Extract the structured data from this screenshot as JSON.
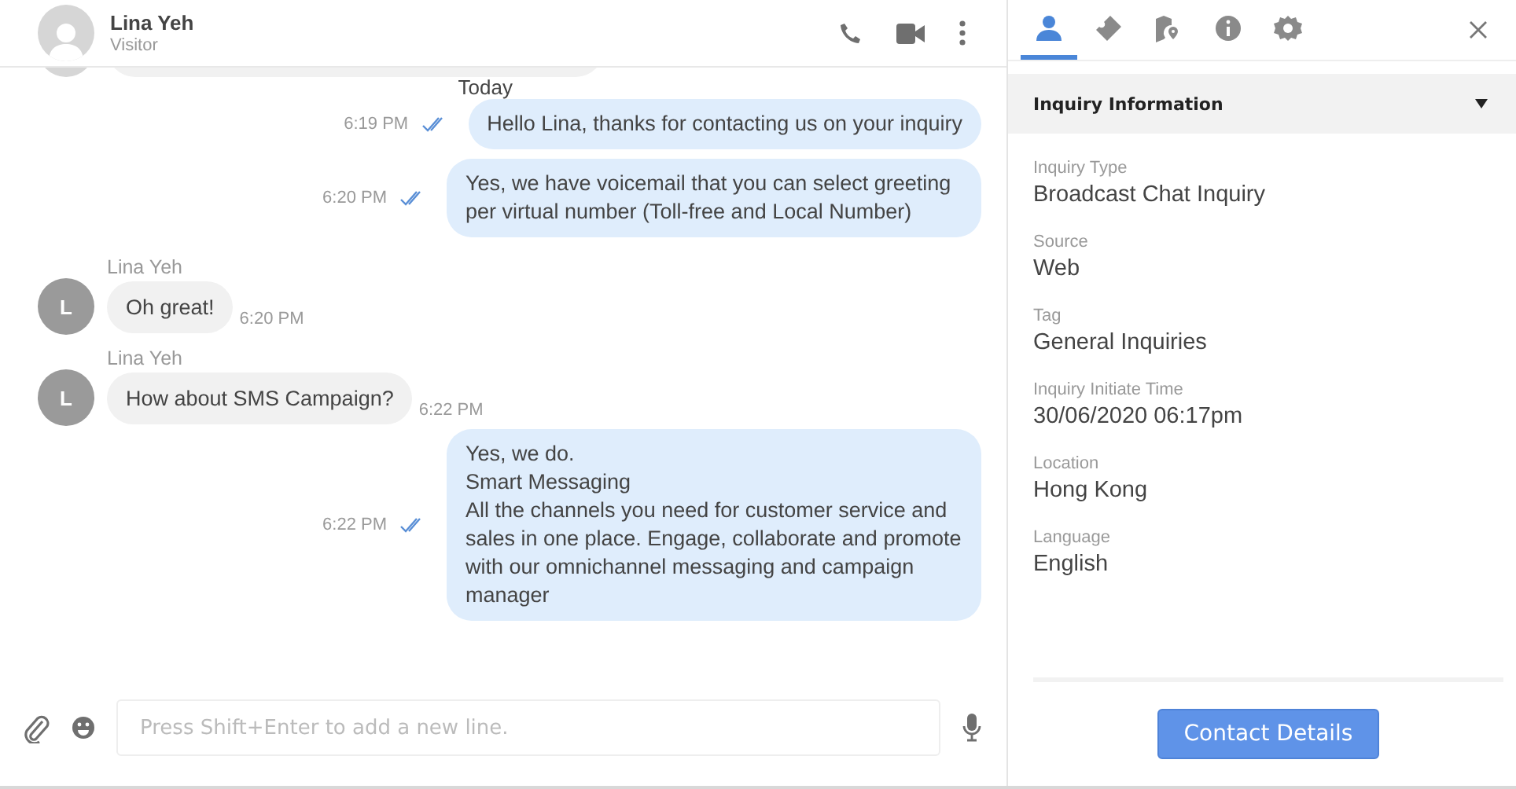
{
  "header": {
    "name": "Lina Yeh",
    "status": "Visitor"
  },
  "messages": [
    {
      "kind": "cut"
    },
    {
      "kind": "date",
      "text": "Today"
    },
    {
      "kind": "outgoing",
      "text": "Hello Lina, thanks for contacting us on your inquiry",
      "time": "6:19 PM",
      "read": true
    },
    {
      "kind": "outgoing",
      "text": "Yes, we have voicemail that you can select greeting per virtual number (Toll-free and Local Number)",
      "time": "6:20 PM",
      "read": true
    },
    {
      "kind": "incoming",
      "sender": "Lina Yeh",
      "avatar": "L",
      "text": "Oh great!",
      "time": "6:20 PM"
    },
    {
      "kind": "incoming",
      "sender": "Lina Yeh",
      "avatar": "L",
      "text": "How about SMS Campaign?",
      "time": "6:22 PM"
    },
    {
      "kind": "outgoing",
      "text": "Yes, we do.\nSmart Messaging\nAll the channels you need for customer service and sales in one place. Engage, collaborate and promote with our omnichannel messaging and campaign manager",
      "time": "6:22 PM",
      "read": true
    }
  ],
  "composer": {
    "placeholder": "Press Shift+Enter to add a new line."
  },
  "panel": {
    "tabs": [
      {
        "kind": "person",
        "selected": true
      },
      {
        "kind": "ticket",
        "selected": false
      },
      {
        "kind": "map",
        "selected": false
      },
      {
        "kind": "info",
        "selected": false
      },
      {
        "kind": "settings",
        "selected": false
      }
    ],
    "section": {
      "title": "Inquiry Information",
      "expanded": true
    },
    "fields": [
      {
        "label": "Inquiry Type",
        "value": "Broadcast Chat Inquiry"
      },
      {
        "label": "Source",
        "value": "Web"
      },
      {
        "label": "Tag",
        "value": "General Inquiries"
      },
      {
        "label": "Inquiry Initiate Time",
        "value": "30/06/2020 06:17pm"
      },
      {
        "label": "Location",
        "value": "Hong Kong"
      },
      {
        "label": "Language",
        "value": "English"
      }
    ],
    "button": "Contact Details"
  }
}
